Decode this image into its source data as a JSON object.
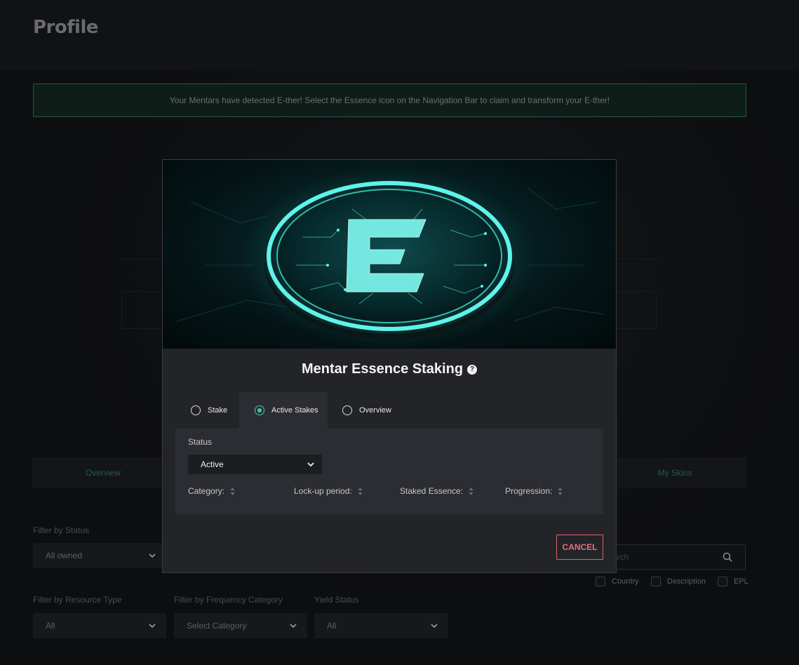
{
  "page": {
    "title": "Profile",
    "notice": "Your Mentars have detected E-ther! Select the Essence icon on the Navigation Bar to claim and transform your E-ther!"
  },
  "background_tabs": [
    {
      "label": "Overview"
    },
    {
      "label": "My Skins"
    }
  ],
  "filters": {
    "status": {
      "label": "Filter by Status",
      "value": "All owned"
    },
    "resource_type": {
      "label": "Filter by Resource Type",
      "value": "All"
    },
    "frequency_category": {
      "label": "Filter by Frequency Category",
      "value": "Select Category"
    },
    "yield_status": {
      "label": "Yield Status",
      "value": "All"
    },
    "search": {
      "placeholder": "Search",
      "visible_text": "arch"
    },
    "checkboxes": [
      {
        "label": "Country"
      },
      {
        "label": "Description"
      },
      {
        "label": "EPL"
      }
    ]
  },
  "modal": {
    "title": "Mentar Essence Staking",
    "help_icon": "?",
    "tabs": [
      {
        "label": "Stake",
        "selected": false
      },
      {
        "label": "Active Stakes",
        "selected": true
      },
      {
        "label": "Overview",
        "selected": false
      }
    ],
    "status_label": "Status",
    "status_value": "Active",
    "columns": [
      {
        "label": "Category:"
      },
      {
        "label": "Lock-up period:"
      },
      {
        "label": "Staked Essence:"
      },
      {
        "label": "Progression:"
      }
    ],
    "cancel_label": "CANCEL"
  },
  "icons": {
    "chevron": "chevron-down-icon",
    "search": "search-icon",
    "sort": "sort-icon",
    "help": "help-icon",
    "hero": "essence-coin-icon"
  },
  "colors": {
    "accent": "#3fcfa6",
    "cancel": "#e0616d",
    "notice_border": "#1e5a46"
  }
}
